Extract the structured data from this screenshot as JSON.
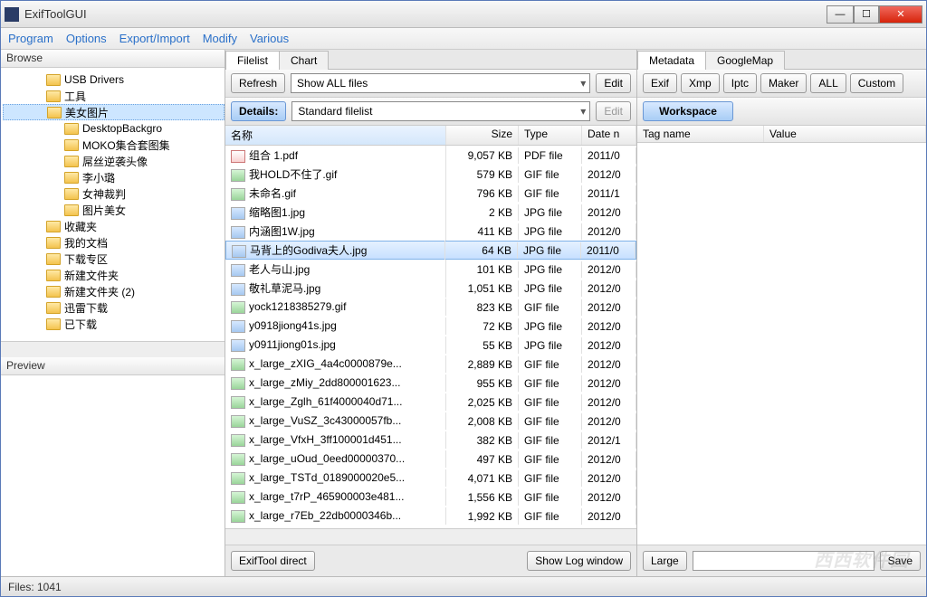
{
  "title": "ExifToolGUI",
  "menu": [
    "Program",
    "Options",
    "Export/Import",
    "Modify",
    "Various"
  ],
  "browse_label": "Browse",
  "preview_label": "Preview",
  "tree": [
    {
      "label": "USB Drivers",
      "depth": 1
    },
    {
      "label": "工具",
      "depth": 1
    },
    {
      "label": "美女图片",
      "depth": 1,
      "selected": true
    },
    {
      "label": "DesktopBackgro",
      "depth": 2
    },
    {
      "label": "MOKO集合套图集",
      "depth": 2
    },
    {
      "label": "屌丝逆袭头像",
      "depth": 2
    },
    {
      "label": "李小璐",
      "depth": 2
    },
    {
      "label": "女神裁判",
      "depth": 2
    },
    {
      "label": "图片美女",
      "depth": 2
    },
    {
      "label": "收藏夹",
      "depth": 1
    },
    {
      "label": "我的文档",
      "depth": 1
    },
    {
      "label": "下载专区",
      "depth": 1
    },
    {
      "label": "新建文件夹",
      "depth": 1
    },
    {
      "label": "新建文件夹 (2)",
      "depth": 1
    },
    {
      "label": "迅雷下载",
      "depth": 1
    },
    {
      "label": "已下载",
      "depth": 1
    }
  ],
  "center_tabs": [
    "Filelist",
    "Chart"
  ],
  "toolbar": {
    "refresh": "Refresh",
    "show_filter": "Show ALL files",
    "edit": "Edit",
    "details": "Details:",
    "details_combo": "Standard filelist",
    "edit2": "Edit"
  },
  "columns": {
    "name": "名称",
    "size": "Size",
    "type": "Type",
    "date": "Date n"
  },
  "files": [
    {
      "name": "组合 1.pdf",
      "size": "9,057 KB",
      "type": "PDF file",
      "date": "2011/0",
      "icon": "pdf"
    },
    {
      "name": "我HOLD不住了.gif",
      "size": "579 KB",
      "type": "GIF file",
      "date": "2012/0",
      "icon": "gif"
    },
    {
      "name": "未命名.gif",
      "size": "796 KB",
      "type": "GIF file",
      "date": "2011/1",
      "icon": "gif"
    },
    {
      "name": "缩略图1.jpg",
      "size": "2 KB",
      "type": "JPG file",
      "date": "2012/0",
      "icon": "jpg"
    },
    {
      "name": "内涵图1W.jpg",
      "size": "411 KB",
      "type": "JPG file",
      "date": "2012/0",
      "icon": "jpg"
    },
    {
      "name": "马背上的Godiva夫人.jpg",
      "size": "64 KB",
      "type": "JPG file",
      "date": "2011/0",
      "icon": "jpg",
      "selected": true
    },
    {
      "name": "老人与山.jpg",
      "size": "101 KB",
      "type": "JPG file",
      "date": "2012/0",
      "icon": "jpg"
    },
    {
      "name": "敬礼草泥马.jpg",
      "size": "1,051 KB",
      "type": "JPG file",
      "date": "2012/0",
      "icon": "jpg"
    },
    {
      "name": "yock1218385279.gif",
      "size": "823 KB",
      "type": "GIF file",
      "date": "2012/0",
      "icon": "gif"
    },
    {
      "name": "y0918jiong41s.jpg",
      "size": "72 KB",
      "type": "JPG file",
      "date": "2012/0",
      "icon": "jpg"
    },
    {
      "name": "y0911jiong01s.jpg",
      "size": "55 KB",
      "type": "JPG file",
      "date": "2012/0",
      "icon": "jpg"
    },
    {
      "name": "x_large_zXIG_4a4c0000879e...",
      "size": "2,889 KB",
      "type": "GIF file",
      "date": "2012/0",
      "icon": "gif"
    },
    {
      "name": "x_large_zMiy_2dd800001623...",
      "size": "955 KB",
      "type": "GIF file",
      "date": "2012/0",
      "icon": "gif"
    },
    {
      "name": "x_large_Zglh_61f4000040d71...",
      "size": "2,025 KB",
      "type": "GIF file",
      "date": "2012/0",
      "icon": "gif"
    },
    {
      "name": "x_large_VuSZ_3c43000057fb...",
      "size": "2,008 KB",
      "type": "GIF file",
      "date": "2012/0",
      "icon": "gif"
    },
    {
      "name": "x_large_VfxH_3ff100001d451...",
      "size": "382 KB",
      "type": "GIF file",
      "date": "2012/1",
      "icon": "gif"
    },
    {
      "name": "x_large_uOud_0eed00000370...",
      "size": "497 KB",
      "type": "GIF file",
      "date": "2012/0",
      "icon": "gif"
    },
    {
      "name": "x_large_TSTd_0189000020e5...",
      "size": "4,071 KB",
      "type": "GIF file",
      "date": "2012/0",
      "icon": "gif"
    },
    {
      "name": "x_large_t7rP_465900003e481...",
      "size": "1,556 KB",
      "type": "GIF file",
      "date": "2012/0",
      "icon": "gif"
    },
    {
      "name": "x_large_r7Eb_22db0000346b...",
      "size": "1,992 KB",
      "type": "GIF file",
      "date": "2012/0",
      "icon": "gif"
    }
  ],
  "bottom": {
    "exiftool": "ExifTool direct",
    "log": "Show Log window"
  },
  "right_tabs": [
    "Metadata",
    "GoogleMap"
  ],
  "meta_buttons": [
    "Exif",
    "Xmp",
    "Iptc",
    "Maker",
    "ALL",
    "Custom"
  ],
  "workspace": "Workspace",
  "meta_cols": {
    "tag": "Tag name",
    "value": "Value"
  },
  "meta_bottom": {
    "large": "Large",
    "save": "Save"
  },
  "status": "Files: 1041",
  "watermark": "西西软件园"
}
